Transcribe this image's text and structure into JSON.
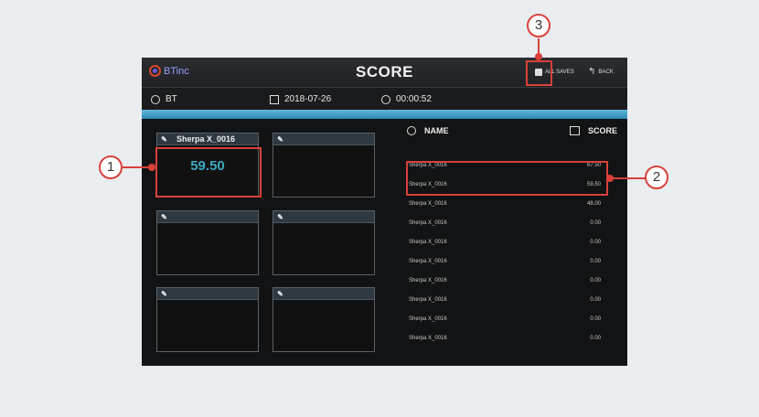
{
  "header": {
    "logo_text": "BTinc",
    "title": "SCORE",
    "all_saves_label": "ALL SAVES",
    "back_label": "BACK"
  },
  "info": {
    "user": "BT",
    "date": "2018-07-26",
    "time": "00:00:52"
  },
  "progress": {
    "fraction": 1.0
  },
  "cards": [
    {
      "name": "Sherpa X_0016",
      "score": "59.50"
    },
    {
      "name": "",
      "score": ""
    },
    {
      "name": "",
      "score": ""
    },
    {
      "name": "",
      "score": ""
    },
    {
      "name": "",
      "score": ""
    },
    {
      "name": "",
      "score": ""
    }
  ],
  "list": {
    "name_header": "NAME",
    "score_header": "SCORE",
    "rows": [
      {
        "name": "Sherpa X_0016",
        "score": "67.50"
      },
      {
        "name": "Sherpa X_0016",
        "score": "59.50"
      },
      {
        "name": "Sherpa X_0016",
        "score": "48.00"
      },
      {
        "name": "Sherpa X_0016",
        "score": "0.00"
      },
      {
        "name": "Sherpa X_0016",
        "score": "0.00"
      },
      {
        "name": "Sherpa X_0016",
        "score": "0.00"
      },
      {
        "name": "Sherpa X_0016",
        "score": "0.00"
      },
      {
        "name": "Sherpa X_0016",
        "score": "0.00"
      },
      {
        "name": "Sherpa X_0016",
        "score": "0.00"
      },
      {
        "name": "Sherpa X_0016",
        "score": "0.00"
      }
    ]
  },
  "callouts": [
    "1",
    "2",
    "3"
  ],
  "colors": {
    "highlight": "#d8413a",
    "accent": "#3fa8c2"
  }
}
